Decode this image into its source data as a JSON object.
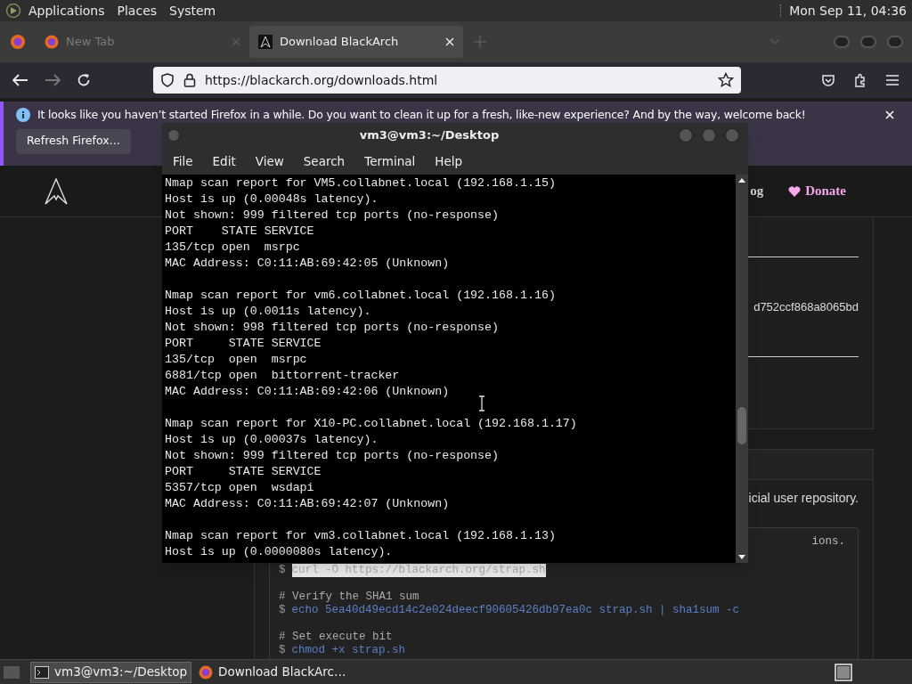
{
  "top_panel": {
    "menus": [
      "Applications",
      "Places",
      "System"
    ],
    "clock": "Mon Sep 11, 04:36"
  },
  "browser": {
    "tabs": [
      {
        "title": "New Tab",
        "selected": false
      },
      {
        "title": "Download BlackArch",
        "selected": true
      }
    ],
    "url": "https://blackarch.org/downloads.html",
    "notification": {
      "message": "It looks like you haven’t started Firefox in a while. Do you want to clean it up for a fresh, like-new experience? And by the way, welcome back!",
      "button": "Refresh Firefox…"
    },
    "page": {
      "nav_links": [
        {
          "label": "og",
          "kind": "plain"
        },
        {
          "label": "Donate",
          "kind": "donate"
        }
      ],
      "checksum_fragment": "d752ccf868a8065bd",
      "repo_text_fragment": "icial user repository.",
      "code_note_fragment": "ions.",
      "code_lines": [
        {
          "kind": "command",
          "prompt": "$",
          "text": "curl -O https://blackarch.org/strap.sh",
          "selected": true
        },
        {
          "kind": "blank"
        },
        {
          "kind": "comment",
          "text": "# Verify the SHA1 sum"
        },
        {
          "kind": "command",
          "prompt": "$",
          "text": "echo 5ea40d49ecd14c2e024deecf90605426db97ea0c strap.sh | sha1sum -c",
          "selected": false
        },
        {
          "kind": "blank"
        },
        {
          "kind": "comment",
          "text": "# Set execute bit"
        },
        {
          "kind": "command",
          "prompt": "$",
          "text": "chmod +x strap.sh",
          "selected": false
        }
      ]
    }
  },
  "terminal": {
    "title": "vm3@vm3:~/Desktop",
    "menu": [
      "File",
      "Edit",
      "View",
      "Search",
      "Terminal",
      "Help"
    ],
    "blocks": [
      [
        "Nmap scan report for VM5.collabnet.local (192.168.1.15)",
        "Host is up (0.00048s latency).",
        "Not shown: 999 filtered tcp ports (no-response)",
        "PORT    STATE SERVICE",
        "135/tcp open  msrpc",
        "MAC Address: C0:11:AB:69:42:05 (Unknown)"
      ],
      [
        "Nmap scan report for vm6.collabnet.local (192.168.1.16)",
        "Host is up (0.0011s latency).",
        "Not shown: 998 filtered tcp ports (no-response)",
        "PORT     STATE SERVICE",
        "135/tcp  open  msrpc",
        "6881/tcp open  bittorrent-tracker",
        "MAC Address: C0:11:AB:69:42:06 (Unknown)"
      ],
      [
        "Nmap scan report for X10-PC.collabnet.local (192.168.1.17)",
        "Host is up (0.00037s latency).",
        "Not shown: 999 filtered tcp ports (no-response)",
        "PORT     STATE SERVICE",
        "5357/tcp open  wsdapi",
        "MAC Address: C0:11:AB:69:42:07 (Unknown)"
      ],
      [
        "Nmap scan report for vm3.collabnet.local (192.168.1.13)",
        "Host is up (0.0000080s latency)."
      ]
    ]
  },
  "taskbar": {
    "items": [
      {
        "label": "vm3@vm3:~/Desktop",
        "kind": "terminal",
        "selected": true
      },
      {
        "label": "Download BlackArc…",
        "kind": "firefox",
        "selected": false
      }
    ]
  }
}
